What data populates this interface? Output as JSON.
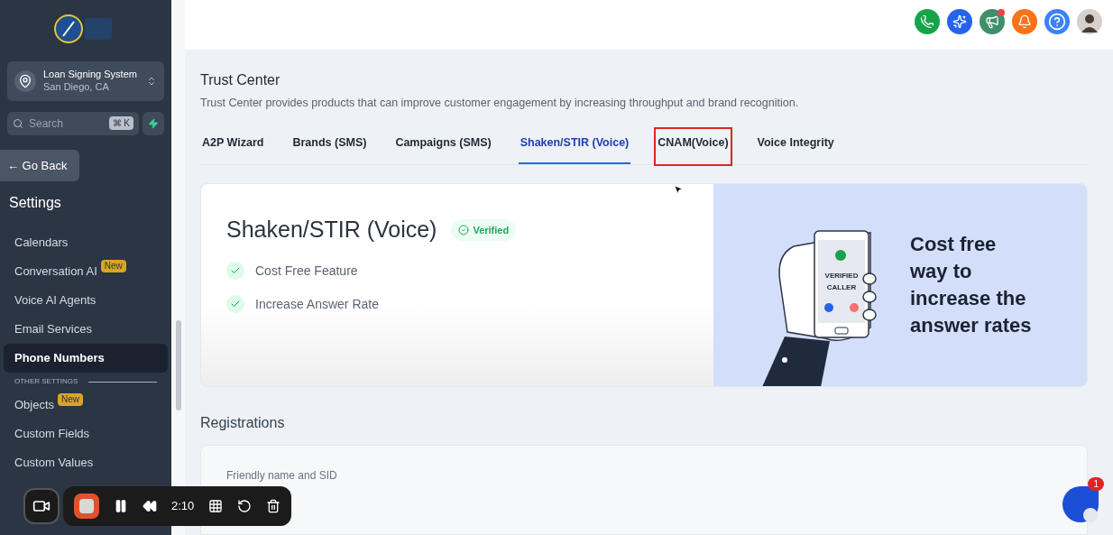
{
  "sidebar": {
    "account": {
      "name": "Loan Signing System",
      "location": "San Diego, CA"
    },
    "search": {
      "placeholder": "Search",
      "shortcut": "⌘ K"
    },
    "back_button": "← Go Back",
    "section_title": "Settings",
    "items": [
      {
        "label": "Calendars",
        "selected": false
      },
      {
        "label": "Conversation AI",
        "badge": "New",
        "selected": false
      },
      {
        "label": "Voice AI Agents",
        "selected": false
      },
      {
        "label": "Email Services",
        "selected": false
      },
      {
        "label": "Phone Numbers",
        "selected": true
      }
    ],
    "group_label": "OTHER SETTINGS",
    "other_items": [
      {
        "label": "Objects",
        "badge": "New",
        "selected": false
      },
      {
        "label": "Custom Fields",
        "selected": false
      },
      {
        "label": "Custom Values",
        "selected": false
      }
    ]
  },
  "header": {
    "notification_dot": true
  },
  "page": {
    "title": "Trust Center",
    "description": "Trust Center provides products that can improve customer engagement by increasing throughput and brand recognition.",
    "tabs": [
      {
        "label": "A2P Wizard",
        "selected": false,
        "highlighted": false
      },
      {
        "label": "Brands (SMS)",
        "selected": false,
        "highlighted": false
      },
      {
        "label": "Campaigns (SMS)",
        "selected": false,
        "highlighted": false
      },
      {
        "label": "Shaken/STIR (Voice)",
        "selected": true,
        "highlighted": false
      },
      {
        "label": "CNAM(Voice)",
        "selected": false,
        "highlighted": true
      },
      {
        "label": "Voice Integrity",
        "selected": false,
        "highlighted": false
      }
    ],
    "card": {
      "title": "Shaken/STIR (Voice)",
      "status": "Verified",
      "features": [
        "Cost Free Feature",
        "Increase Answer Rate"
      ],
      "phone_lines": [
        "VERIFIED",
        "CALLER"
      ],
      "promo": "Cost free way to increase the answer rates"
    },
    "registrations": {
      "title": "Registrations",
      "field_label": "Friendly name and SID"
    }
  },
  "recorder": {
    "time": "2:10"
  },
  "chat": {
    "badge": "1"
  }
}
